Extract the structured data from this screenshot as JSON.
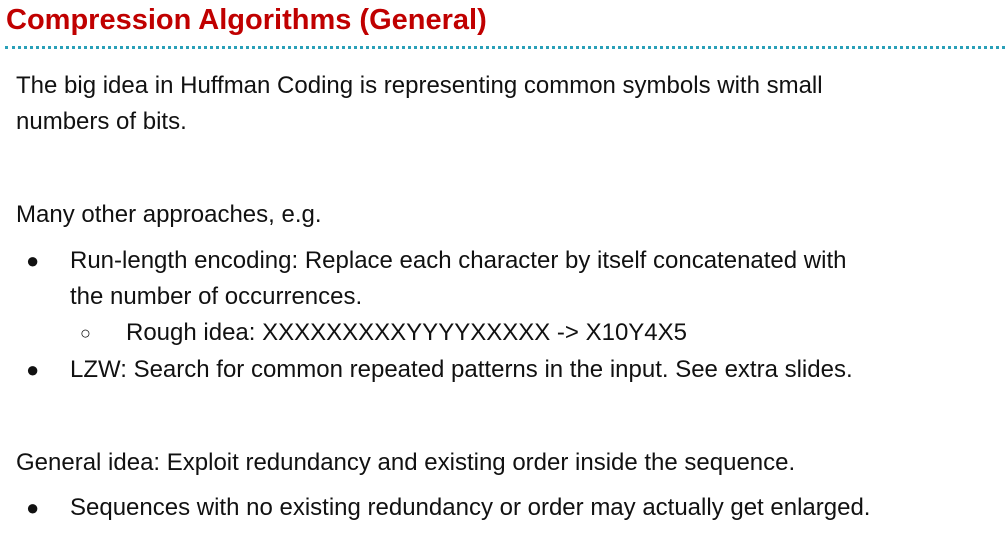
{
  "slide": {
    "title": "Compression Algorithms (General)",
    "intro": {
      "line1": "The big idea in Huffman Coding is representing common symbols with small",
      "line2": "numbers of bits."
    },
    "approaches": {
      "heading": "Many other approaches, e.g.",
      "bullet_symbol": "●",
      "sub_bullet_symbol": "○",
      "items": [
        {
          "line1": "Run-length encoding: Replace each character by itself concatenated with",
          "line2": "the number of occurrences.",
          "sub": "Rough idea: XXXXXXXXXYYYYXXXXX -> X10Y4X5"
        },
        {
          "line1": "LZW: Search for common repeated patterns in the input. See extra slides."
        }
      ]
    },
    "general": {
      "heading": "General idea: Exploit redundancy and existing order inside the sequence.",
      "items": [
        {
          "line1": "Sequences with no existing redundancy or order may actually get enlarged."
        }
      ]
    }
  }
}
